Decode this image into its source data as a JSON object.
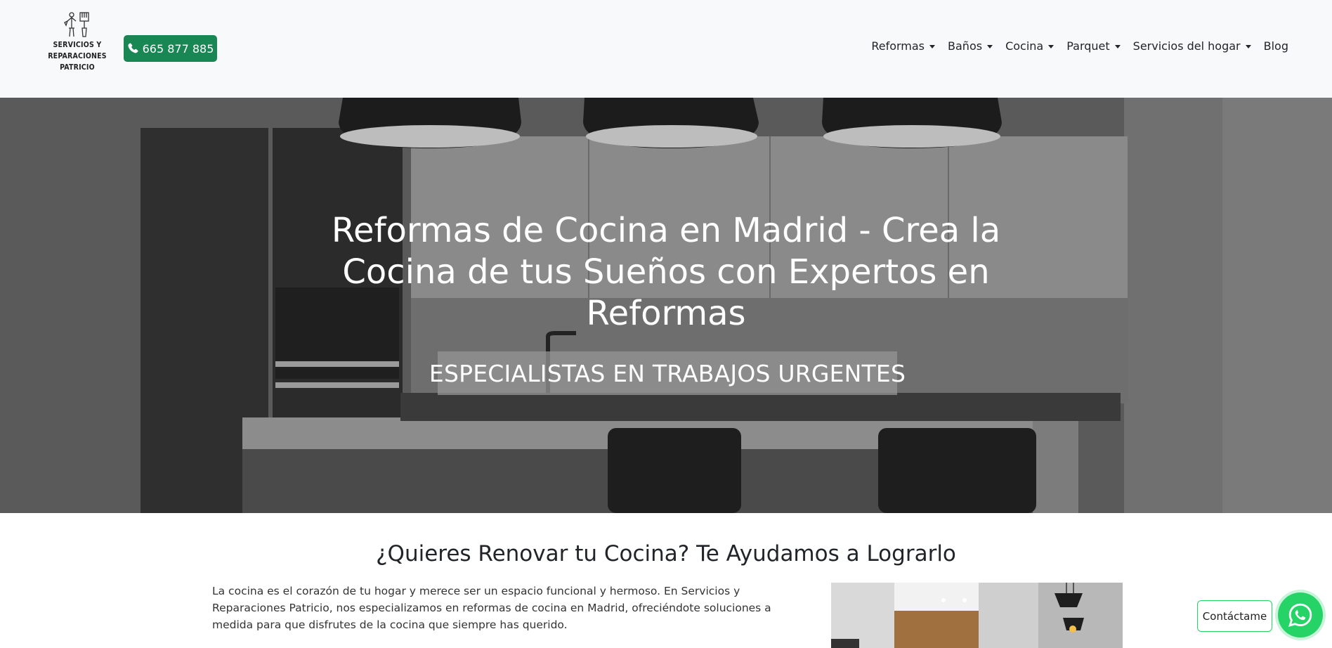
{
  "header": {
    "logo_text": "SERVICIOS Y\nREPARACIONES\nPATRICIO",
    "phone": "665 877 885",
    "nav": [
      {
        "label": "Reformas",
        "dropdown": true
      },
      {
        "label": "Baños",
        "dropdown": true
      },
      {
        "label": "Cocina",
        "dropdown": true
      },
      {
        "label": "Parquet",
        "dropdown": true
      },
      {
        "label": "Servicios del hogar",
        "dropdown": true
      },
      {
        "label": "Blog",
        "dropdown": false
      }
    ]
  },
  "hero": {
    "title": "Reformas de Cocina en Madrid - Crea la Cocina de tus Sueños con Expertos en Reformas",
    "badge": "ESPECIALISTAS EN TRABAJOS URGENTES"
  },
  "intro": {
    "title": "¿Quieres Renovar tu Cocina? Te Ayudamos a Lograrlo",
    "text": "La cocina es el corazón de tu hogar y merece ser un espacio funcional y hermoso. En Servicios y Reparaciones Patricio, nos especializamos en reformas de cocina en Madrid, ofreciéndote soluciones a medida para que disfrutes de la cocina que siempre has querido."
  },
  "contact": {
    "label": "Contáctame"
  },
  "colors": {
    "primary_green": "#198754",
    "whatsapp_green": "#25d366",
    "navbar_bg": "#f8f9fa"
  },
  "icons": [
    "tools-logo-icon",
    "phone-icon",
    "whatsapp-icon"
  ]
}
